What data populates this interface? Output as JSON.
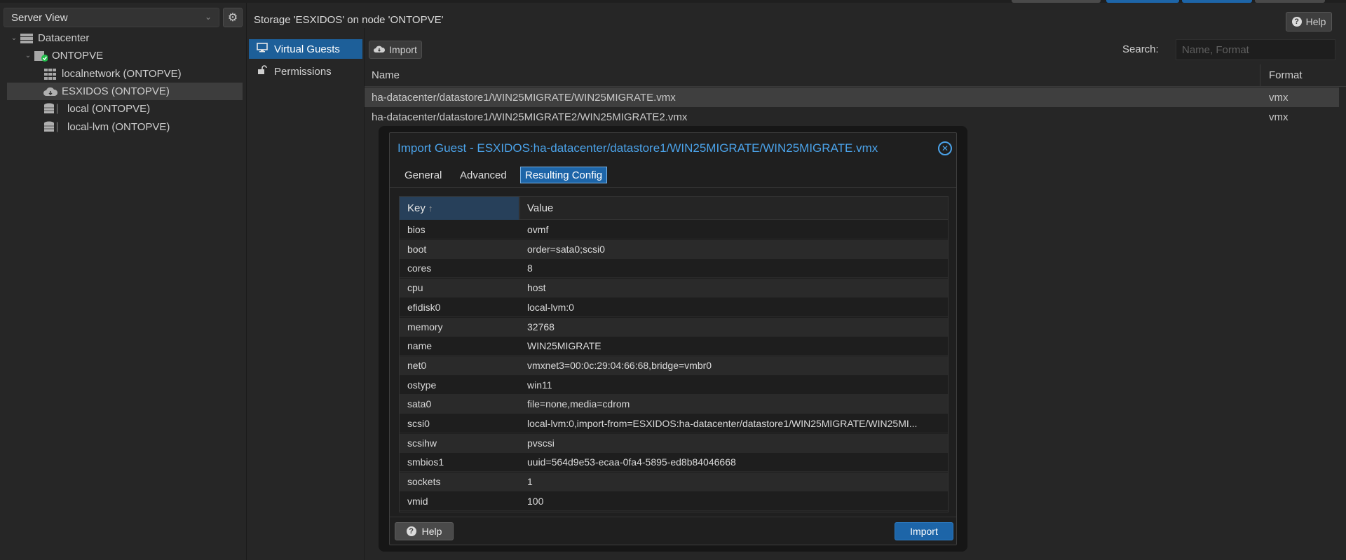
{
  "tree": {
    "view_label": "Server View",
    "items": [
      {
        "label": "Datacenter",
        "icon": "datacenter-icon"
      },
      {
        "label": "ONTOPVE",
        "icon": "node-online-icon"
      },
      {
        "label": "localnetwork (ONTOPVE)",
        "icon": "sdn-zone-icon"
      },
      {
        "label": "ESXIDOS (ONTOPVE)",
        "icon": "esxi-storage-icon"
      },
      {
        "label": "local (ONTOPVE)",
        "icon": "storage-icon"
      },
      {
        "label": "local-lvm (ONTOPVE)",
        "icon": "storage-icon"
      }
    ]
  },
  "storage": {
    "title": "Storage 'ESXIDOS' on node 'ONTOPVE'",
    "help_label": "Help",
    "nav": [
      {
        "label": "Virtual Guests",
        "icon": "monitor-icon"
      },
      {
        "label": "Permissions",
        "icon": "unlock-icon"
      }
    ],
    "toolbar": {
      "import_label": "Import",
      "search_label": "Search:",
      "search_placeholder": "Name, Format"
    },
    "grid": {
      "columns": [
        "Name",
        "Format"
      ],
      "rows": [
        {
          "name": "ha-datacenter/datastore1/WIN25MIGRATE/WIN25MIGRATE.vmx",
          "format": "vmx"
        },
        {
          "name": "ha-datacenter/datastore1/WIN25MIGRATE2/WIN25MIGRATE2.vmx",
          "format": "vmx"
        }
      ]
    }
  },
  "dialog": {
    "title": "Import Guest - ESXIDOS:ha-datacenter/datastore1/WIN25MIGRATE/WIN25MIGRATE.vmx",
    "tabs": [
      "General",
      "Advanced",
      "Resulting Config"
    ],
    "active_tab": "Resulting Config",
    "table": {
      "key_header": "Key",
      "value_header": "Value",
      "rows": [
        {
          "key": "bios",
          "value": "ovmf"
        },
        {
          "key": "boot",
          "value": "order=sata0;scsi0"
        },
        {
          "key": "cores",
          "value": "8"
        },
        {
          "key": "cpu",
          "value": "host"
        },
        {
          "key": "efidisk0",
          "value": "local-lvm:0"
        },
        {
          "key": "memory",
          "value": "32768"
        },
        {
          "key": "name",
          "value": "WIN25MIGRATE"
        },
        {
          "key": "net0",
          "value": "vmxnet3=00:0c:29:04:66:68,bridge=vmbr0"
        },
        {
          "key": "ostype",
          "value": "win11"
        },
        {
          "key": "sata0",
          "value": "file=none,media=cdrom"
        },
        {
          "key": "scsi0",
          "value": "local-lvm:0,import-from=ESXIDOS:ha-datacenter/datastore1/WIN25MIGRATE/WIN25MI..."
        },
        {
          "key": "scsihw",
          "value": "pvscsi"
        },
        {
          "key": "smbios1",
          "value": "uuid=564d9e53-ecaa-0fa4-5895-ed8b84046668"
        },
        {
          "key": "sockets",
          "value": "1"
        },
        {
          "key": "vmid",
          "value": "100"
        }
      ]
    },
    "help_label": "Help",
    "import_label": "Import"
  },
  "colors": {
    "accent": "#1d65a8",
    "title_blue": "#4ba3ea",
    "background": "#262626"
  }
}
